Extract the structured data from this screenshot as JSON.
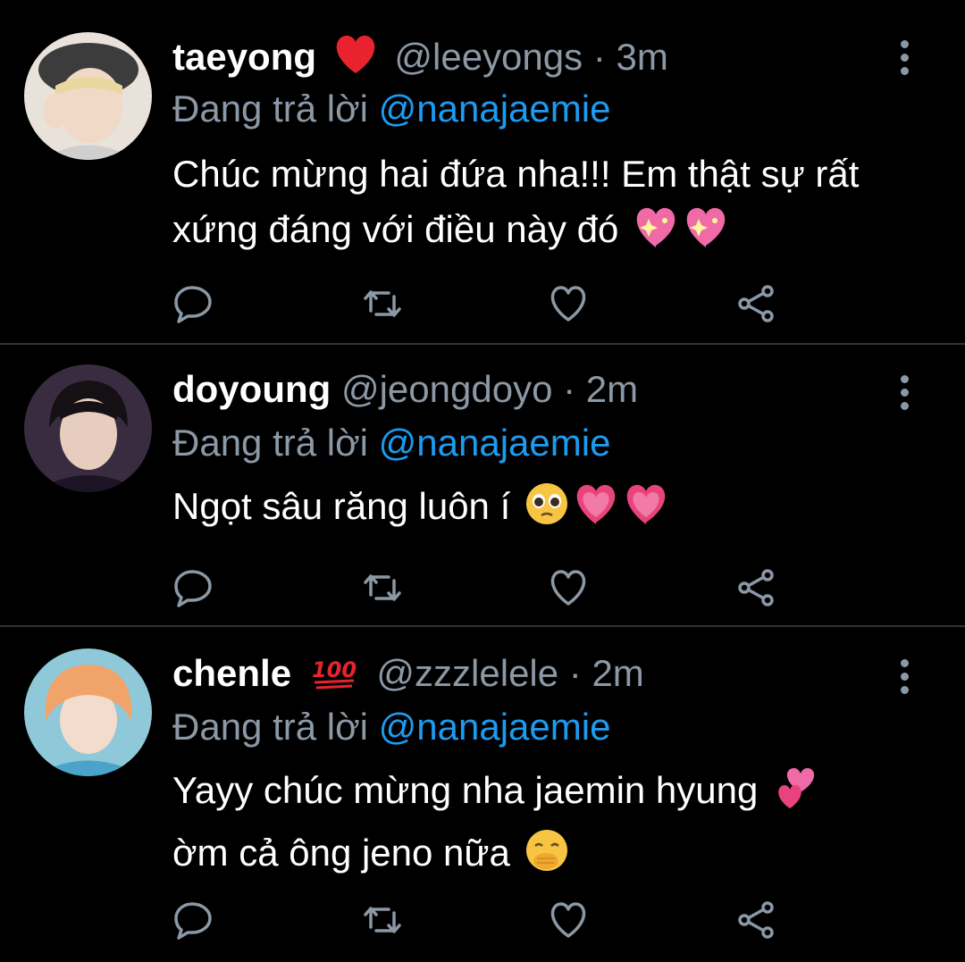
{
  "tweets": [
    {
      "name": "taeyong",
      "badge": "red-heart",
      "handle": "@leeyongs",
      "time": "· 3m",
      "reply_prefix": "Đang trả lời",
      "reply_to": "@nanajaemie",
      "text": "Chúc mừng hai đứa nha!!! Em thật sự rất xứng đáng với điều này đó",
      "emojis": [
        "sparkling-heart",
        "sparkling-heart"
      ]
    },
    {
      "name": "doyoung",
      "badge": "",
      "handle": "@jeongdoyo",
      "time": "· 2m",
      "reply_prefix": "Đang trả lời",
      "reply_to": "@nanajaemie",
      "text": "Ngọt sâu răng luôn í",
      "emojis": [
        "pleading-face",
        "beating-heart",
        "beating-heart"
      ]
    },
    {
      "name": "chenle",
      "badge": "hundred-points",
      "handle": "@zzzlelele",
      "time": "· 2m",
      "reply_prefix": "Đang trả lời",
      "reply_to": "@nanajaemie",
      "text_line1": "Yayy chúc mừng nha jaemin hyung",
      "text_line2": "ờm cả ông jeno nữa",
      "emojis": [
        "two-hearts",
        "hand-over-mouth-face"
      ]
    }
  ],
  "badge_text": {
    "hundred": "100"
  },
  "icons": [
    "reply-icon",
    "retweet-icon",
    "like-icon",
    "share-icon",
    "more-options-icon"
  ],
  "colors": {
    "background": "#000000",
    "secondary": "#8b98a5",
    "link": "#1d9bf0",
    "divider": "#2f3336"
  }
}
